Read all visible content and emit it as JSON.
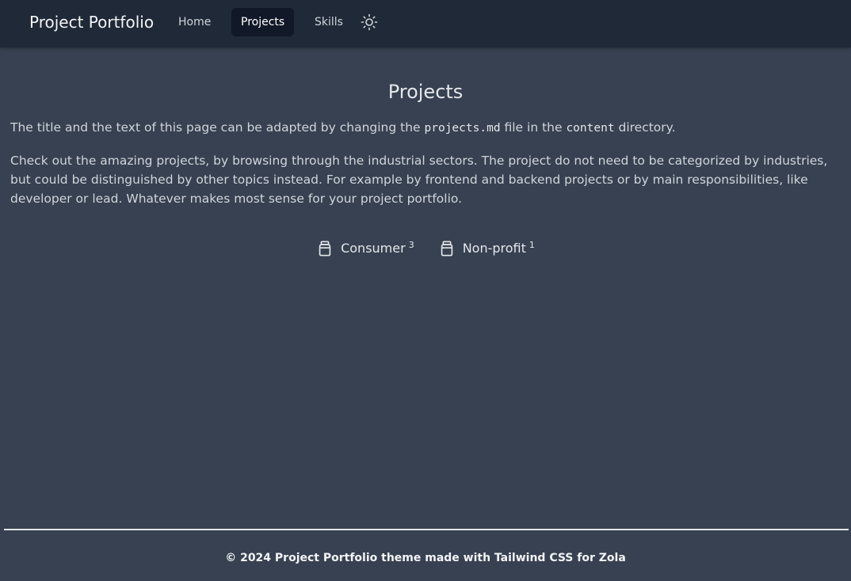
{
  "navbar": {
    "brand": "Project Portfolio",
    "links": [
      {
        "label": "Home",
        "active": false
      },
      {
        "label": "Projects",
        "active": true
      },
      {
        "label": "Skills",
        "active": false
      }
    ],
    "theme_icon": "sun-icon"
  },
  "main": {
    "title": "Projects",
    "intro": {
      "before": "The title and the text of this page can be adapted by changing the ",
      "file": "projects.md",
      "middle": " file in the ",
      "dir": "content",
      "after": " directory."
    },
    "description": "Check out the amazing projects, by browsing through the industrial sectors. The project do not need to be categorized by industries, but could be distinguished by other topics instead. For example by frontend and backend projects or by main responsibilities, like developer or lead. Whatever makes most sense for your project portfolio.",
    "tags": [
      {
        "label": "Consumer",
        "count": "3",
        "icon": "jar-icon"
      },
      {
        "label": "Non-profit",
        "count": "1",
        "icon": "jar-icon"
      }
    ]
  },
  "footer": {
    "text": "© 2024 Project Portfolio theme made with Tailwind CSS for Zola"
  }
}
